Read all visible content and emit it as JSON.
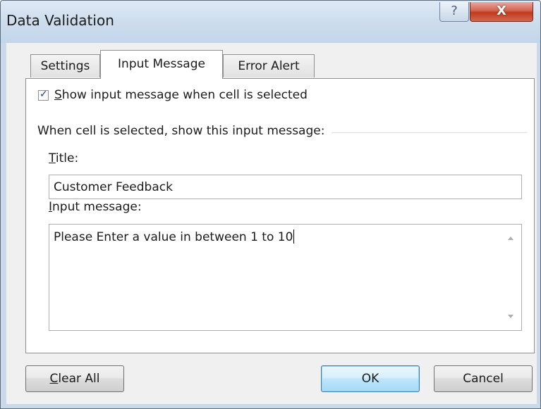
{
  "window": {
    "title": "Data Validation",
    "help_glyph": "?",
    "close_glyph": "X"
  },
  "tabs": [
    {
      "label": "Settings",
      "active": false
    },
    {
      "label": "Input Message",
      "active": true
    },
    {
      "label": "Error Alert",
      "active": false
    }
  ],
  "input_message": {
    "show_checkbox": {
      "checked": true,
      "label_accel": "S",
      "label_rest": "how input message when cell is selected"
    },
    "group_label": "When cell is selected, show this input message:",
    "title_field": {
      "label_accel": "T",
      "label_rest": "itle:",
      "value": "Customer Feedback"
    },
    "message_field": {
      "label_accel": "I",
      "label_rest": "nput message:",
      "value": "Please Enter a value in between 1 to 10"
    }
  },
  "buttons": {
    "clear_all_accel": "C",
    "clear_all_rest": "lear All",
    "ok": "OK",
    "cancel": "Cancel"
  },
  "colors": {
    "title_bar": "#c9d9ea",
    "close_button": "#c0391f",
    "default_button_border": "#3c7fb1",
    "checkmark": "#21427f"
  },
  "icons": {
    "help": "question-mark-icon",
    "close": "close-icon",
    "check": "checkmark-icon",
    "scroll_up": "scroll-up-arrow-icon",
    "scroll_down": "scroll-down-arrow-icon"
  }
}
